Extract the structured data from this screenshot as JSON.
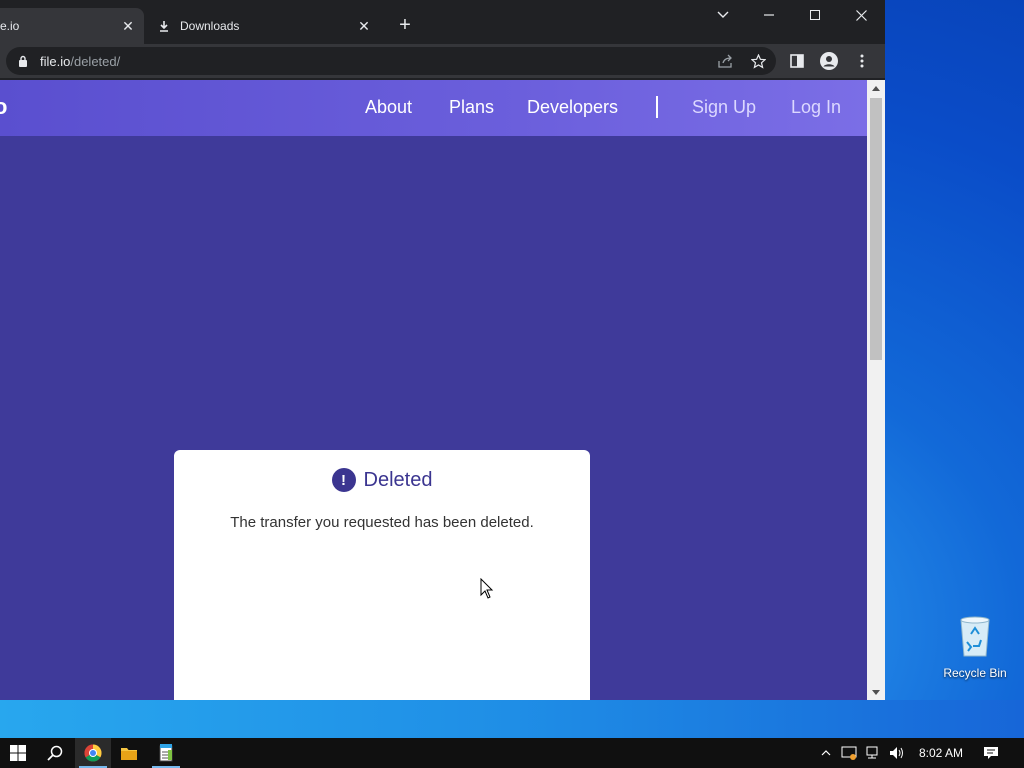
{
  "browser": {
    "tabs": [
      {
        "title": "e.io",
        "close": "✕"
      },
      {
        "title": "Downloads",
        "close": "✕"
      }
    ],
    "new_tab": "+",
    "address": {
      "domain": "file.io",
      "path": "/deleted/"
    },
    "icons": {
      "lock": "lock-icon",
      "share": "share-icon",
      "bookmark": "star-icon",
      "sidepanel": "side-panel-icon",
      "profile": "profile-icon",
      "menu": "kebab-menu-icon"
    }
  },
  "page": {
    "logo_fragment": "o",
    "nav": {
      "about": "About",
      "plans": "Plans",
      "developers": "Developers",
      "signup": "Sign Up",
      "login": "Log In"
    },
    "card": {
      "icon": "!",
      "title": "Deleted",
      "message": "The transfer you requested has been deleted."
    },
    "colors": {
      "background": "#3f3a9a",
      "navbar": "#6b5fdc",
      "accent": "#3b3590"
    }
  },
  "desktop": {
    "recycle_bin": "Recycle Bin"
  },
  "taskbar": {
    "clock": "8:02 AM",
    "apps": [
      "start-icon",
      "search-icon",
      "chrome-icon",
      "file-explorer-icon",
      "notepad-icon"
    ]
  }
}
